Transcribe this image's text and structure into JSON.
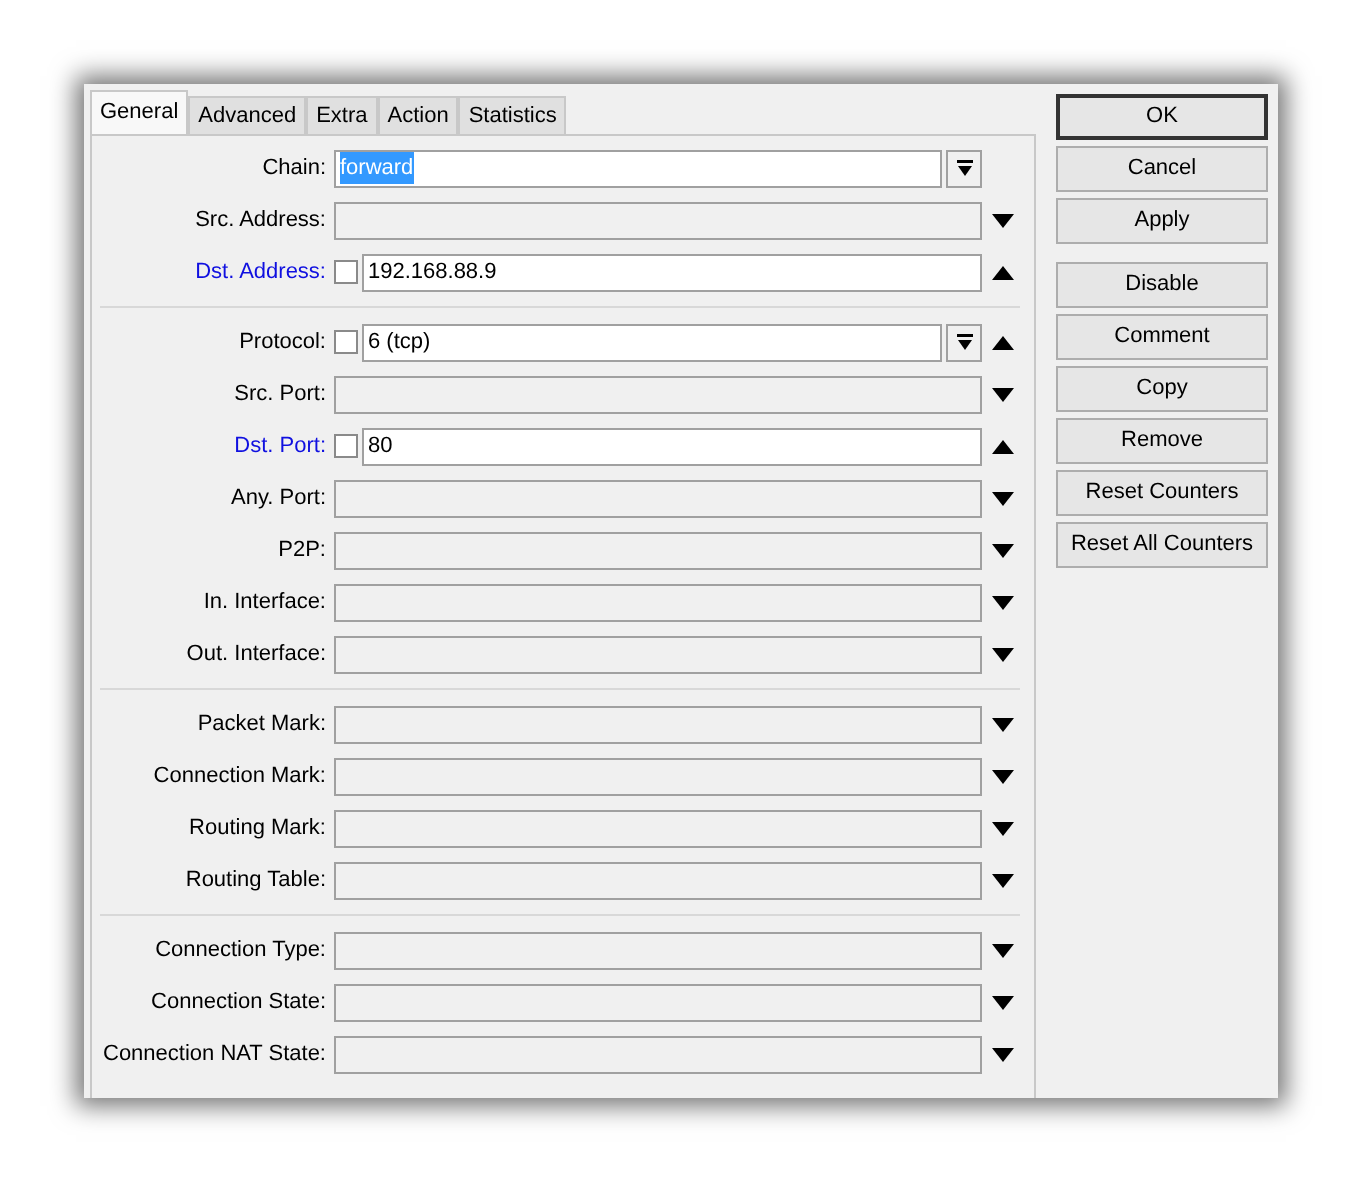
{
  "tabs": [
    {
      "label": "General",
      "selected": true
    },
    {
      "label": "Advanced",
      "selected": false
    },
    {
      "label": "Extra",
      "selected": false
    },
    {
      "label": "Action",
      "selected": false
    },
    {
      "label": "Statistics",
      "selected": false
    }
  ],
  "groups": [
    {
      "fields": [
        {
          "label": "Chain:",
          "kind": "required",
          "highlighted": false,
          "value": "forward",
          "value_selected": true,
          "dropdown": true
        },
        {
          "label": "Src. Address:",
          "kind": "optional",
          "highlighted": false,
          "expanded": false
        },
        {
          "label": "Dst. Address:",
          "kind": "optional",
          "highlighted": true,
          "expanded": true,
          "negate": false,
          "value": "192.168.88.9",
          "dropdown": false
        }
      ]
    },
    {
      "fields": [
        {
          "label": "Protocol:",
          "kind": "optional",
          "highlighted": false,
          "expanded": true,
          "negate": false,
          "value": "6 (tcp)",
          "dropdown": true
        },
        {
          "label": "Src. Port:",
          "kind": "optional",
          "highlighted": false,
          "expanded": false
        },
        {
          "label": "Dst. Port:",
          "kind": "optional",
          "highlighted": true,
          "expanded": true,
          "negate": false,
          "value": "80",
          "dropdown": false
        },
        {
          "label": "Any. Port:",
          "kind": "optional",
          "highlighted": false,
          "expanded": false
        },
        {
          "label": "P2P:",
          "kind": "optional",
          "highlighted": false,
          "expanded": false
        },
        {
          "label": "In. Interface:",
          "kind": "optional",
          "highlighted": false,
          "expanded": false
        },
        {
          "label": "Out. Interface:",
          "kind": "optional",
          "highlighted": false,
          "expanded": false
        }
      ]
    },
    {
      "fields": [
        {
          "label": "Packet Mark:",
          "kind": "optional",
          "highlighted": false,
          "expanded": false
        },
        {
          "label": "Connection Mark:",
          "kind": "optional",
          "highlighted": false,
          "expanded": false
        },
        {
          "label": "Routing Mark:",
          "kind": "optional",
          "highlighted": false,
          "expanded": false
        },
        {
          "label": "Routing Table:",
          "kind": "optional",
          "highlighted": false,
          "expanded": false
        }
      ]
    },
    {
      "fields": [
        {
          "label": "Connection Type:",
          "kind": "optional",
          "highlighted": false,
          "expanded": false
        },
        {
          "label": "Connection State:",
          "kind": "optional",
          "highlighted": false,
          "expanded": false
        },
        {
          "label": "Connection NAT State:",
          "kind": "optional",
          "highlighted": false,
          "expanded": false
        }
      ]
    }
  ],
  "button_groups": [
    [
      {
        "label": "OK",
        "default": true
      },
      {
        "label": "Cancel",
        "default": false
      },
      {
        "label": "Apply",
        "default": false
      }
    ],
    [
      {
        "label": "Disable",
        "default": false
      },
      {
        "label": "Comment",
        "default": false
      },
      {
        "label": "Copy",
        "default": false
      },
      {
        "label": "Remove",
        "default": false
      },
      {
        "label": "Reset Counters",
        "default": false
      },
      {
        "label": "Reset All Counters",
        "default": false
      }
    ]
  ]
}
